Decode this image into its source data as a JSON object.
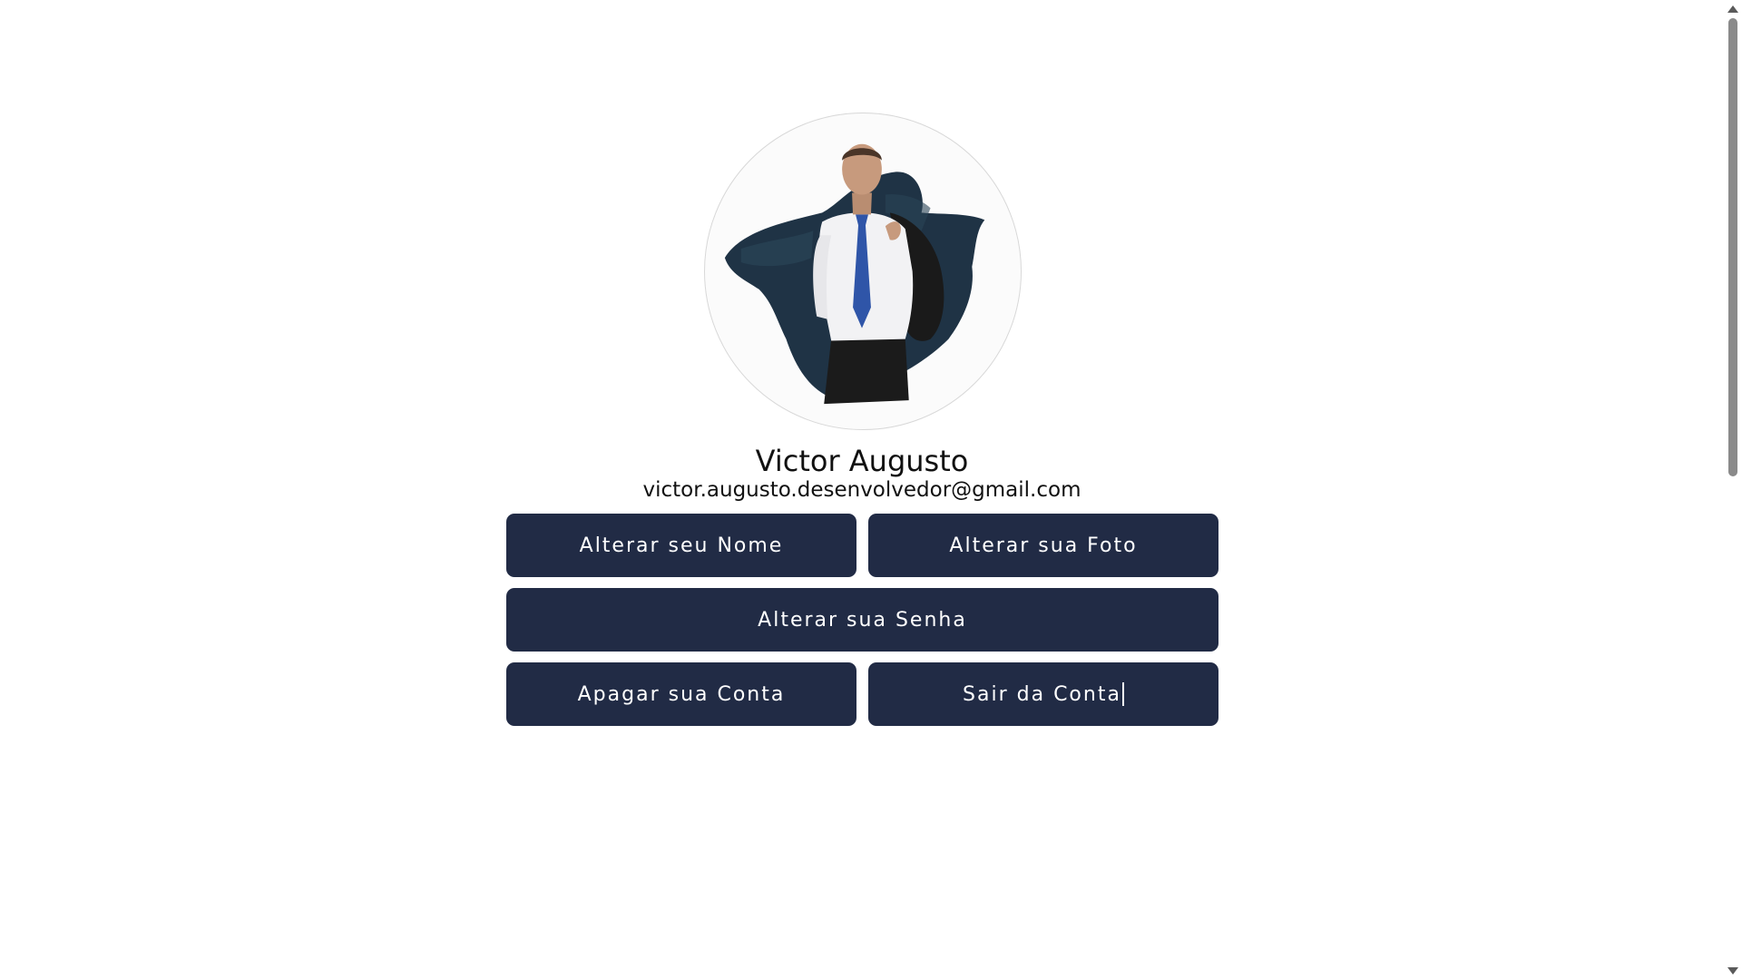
{
  "profile": {
    "name": "Victor Augusto",
    "email": "victor.augusto.desenvolvedor@gmail.com",
    "avatar_icon": "profile-photo"
  },
  "actions": {
    "change_name": "Alterar seu Nome",
    "change_photo": "Alterar sua Foto",
    "change_password": "Alterar sua Senha",
    "delete_account": "Apagar sua Conta",
    "logout": "Sair da Conta"
  },
  "colors": {
    "button_bg": "#212b45",
    "button_text": "#ffffff",
    "text": "#111111",
    "background": "#ffffff"
  },
  "scrollbar": {
    "up_icon": "arrow-up-icon",
    "down_icon": "arrow-down-icon"
  }
}
